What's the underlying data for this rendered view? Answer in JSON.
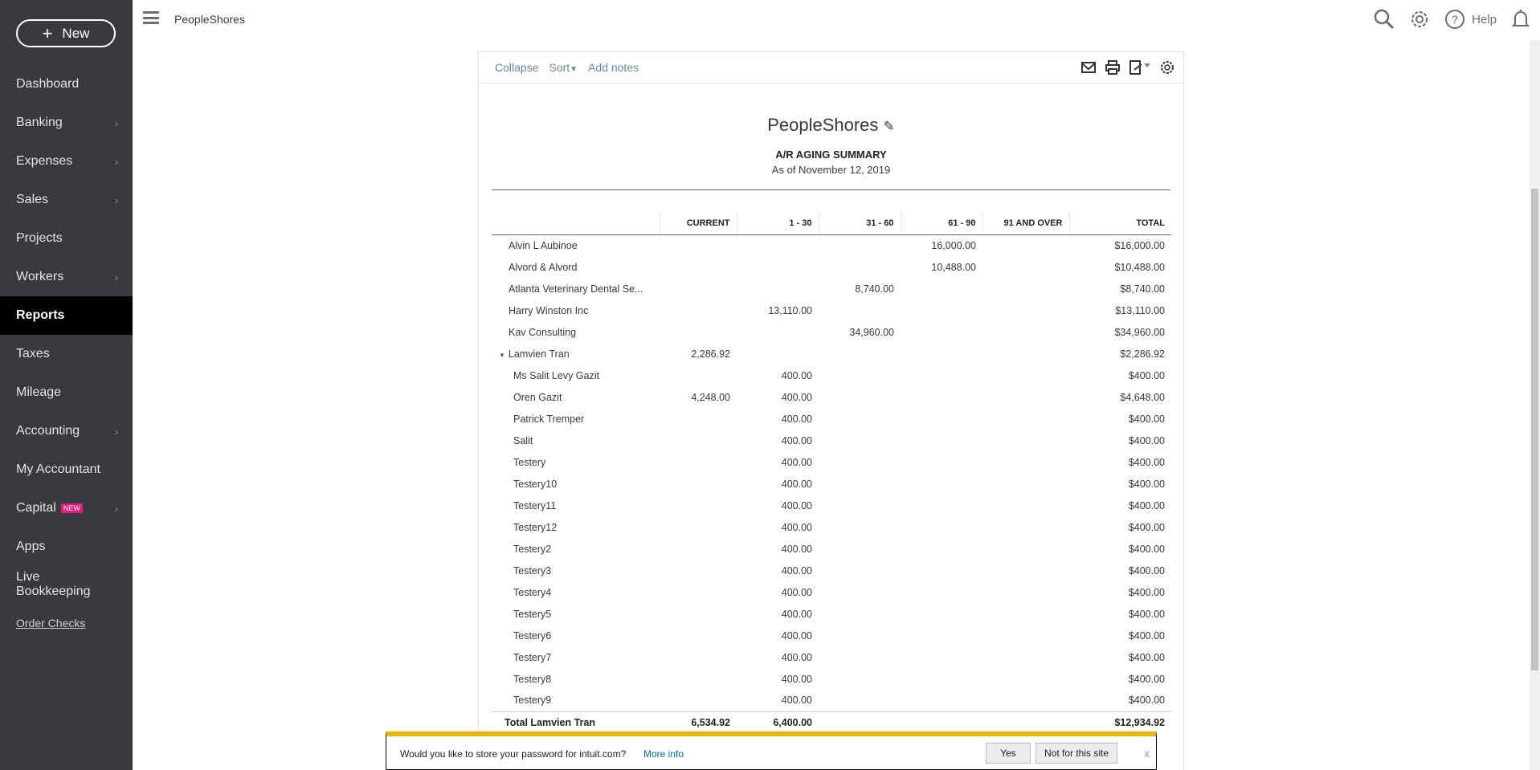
{
  "sidebar": {
    "new_label": "New",
    "items": [
      {
        "label": "Dashboard",
        "chevron": false
      },
      {
        "label": "Banking",
        "chevron": true
      },
      {
        "label": "Expenses",
        "chevron": true
      },
      {
        "label": "Sales",
        "chevron": true
      },
      {
        "label": "Projects",
        "chevron": false
      },
      {
        "label": "Workers",
        "chevron": true
      },
      {
        "label": "Reports",
        "chevron": false,
        "active": true
      },
      {
        "label": "Taxes",
        "chevron": false
      },
      {
        "label": "Mileage",
        "chevron": false
      },
      {
        "label": "Accounting",
        "chevron": true
      },
      {
        "label": "My Accountant",
        "chevron": false
      },
      {
        "label": "Capital",
        "chevron": true,
        "badge": "NEW"
      },
      {
        "label": "Apps",
        "chevron": false
      }
    ],
    "live_bookkeeping": "Live Bookkeeping",
    "order_checks": "Order Checks"
  },
  "header": {
    "company": "PeopleShores",
    "help": "Help"
  },
  "toolbar": {
    "collapse": "Collapse",
    "sort": "Sort",
    "add_notes": "Add notes"
  },
  "report": {
    "company": "PeopleShores",
    "title": "A/R AGING SUMMARY",
    "date": "As of November 12, 2019",
    "columns": [
      "",
      "CURRENT",
      "1 - 30",
      "31 - 60",
      "61 - 90",
      "91 AND OVER",
      "TOTAL"
    ],
    "rows": [
      {
        "name": "Alvin L Aubinoe",
        "v": [
          "",
          "",
          "",
          "16,000.00",
          "",
          "$16,000.00"
        ]
      },
      {
        "name": "Alvord & Alvord",
        "v": [
          "",
          "",
          "",
          "10,488.00",
          "",
          "$10,488.00"
        ]
      },
      {
        "name": "Atlanta Veterinary Dental Se...",
        "v": [
          "",
          "",
          "8,740.00",
          "",
          "",
          "$8,740.00"
        ]
      },
      {
        "name": "Harry Winston Inc",
        "v": [
          "",
          "13,110.00",
          "",
          "",
          "",
          "$13,110.00"
        ]
      },
      {
        "name": "Kav Consulting",
        "v": [
          "",
          "",
          "34,960.00",
          "",
          "",
          "$34,960.00"
        ]
      },
      {
        "name": "Lamvien Tran",
        "parent": true,
        "v": [
          "2,286.92",
          "",
          "",
          "",
          "",
          "$2,286.92"
        ]
      },
      {
        "name": "Ms Salit Levy Gazit",
        "child": true,
        "v": [
          "",
          "400.00",
          "",
          "",
          "",
          "$400.00"
        ]
      },
      {
        "name": "Oren Gazit",
        "child": true,
        "v": [
          "4,248.00",
          "400.00",
          "",
          "",
          "",
          "$4,648.00"
        ]
      },
      {
        "name": "Patrick Tremper",
        "child": true,
        "v": [
          "",
          "400.00",
          "",
          "",
          "",
          "$400.00"
        ]
      },
      {
        "name": "Salit",
        "child": true,
        "v": [
          "",
          "400.00",
          "",
          "",
          "",
          "$400.00"
        ]
      },
      {
        "name": "Testery",
        "child": true,
        "v": [
          "",
          "400.00",
          "",
          "",
          "",
          "$400.00"
        ]
      },
      {
        "name": "Testery10",
        "child": true,
        "v": [
          "",
          "400.00",
          "",
          "",
          "",
          "$400.00"
        ]
      },
      {
        "name": "Testery11",
        "child": true,
        "v": [
          "",
          "400.00",
          "",
          "",
          "",
          "$400.00"
        ]
      },
      {
        "name": "Testery12",
        "child": true,
        "v": [
          "",
          "400.00",
          "",
          "",
          "",
          "$400.00"
        ]
      },
      {
        "name": "Testery2",
        "child": true,
        "v": [
          "",
          "400.00",
          "",
          "",
          "",
          "$400.00"
        ]
      },
      {
        "name": "Testery3",
        "child": true,
        "v": [
          "",
          "400.00",
          "",
          "",
          "",
          "$400.00"
        ]
      },
      {
        "name": "Testery4",
        "child": true,
        "v": [
          "",
          "400.00",
          "",
          "",
          "",
          "$400.00"
        ]
      },
      {
        "name": "Testery5",
        "child": true,
        "v": [
          "",
          "400.00",
          "",
          "",
          "",
          "$400.00"
        ]
      },
      {
        "name": "Testery6",
        "child": true,
        "v": [
          "",
          "400.00",
          "",
          "",
          "",
          "$400.00"
        ]
      },
      {
        "name": "Testery7",
        "child": true,
        "v": [
          "",
          "400.00",
          "",
          "",
          "",
          "$400.00"
        ]
      },
      {
        "name": "Testery8",
        "child": true,
        "v": [
          "",
          "400.00",
          "",
          "",
          "",
          "$400.00"
        ]
      },
      {
        "name": "Testery9",
        "child": true,
        "v": [
          "",
          "400.00",
          "",
          "",
          "",
          "$400.00"
        ]
      }
    ],
    "total": {
      "name": "Total Lamvien Tran",
      "v": [
        "6,534.92",
        "6,400.00",
        "",
        "",
        "",
        "$12,934.92"
      ]
    }
  },
  "password_bar": {
    "message": "Would you like to store your password for intuit.com?",
    "more_info": "More info",
    "yes": "Yes",
    "no": "Not for this site",
    "close": "x"
  }
}
